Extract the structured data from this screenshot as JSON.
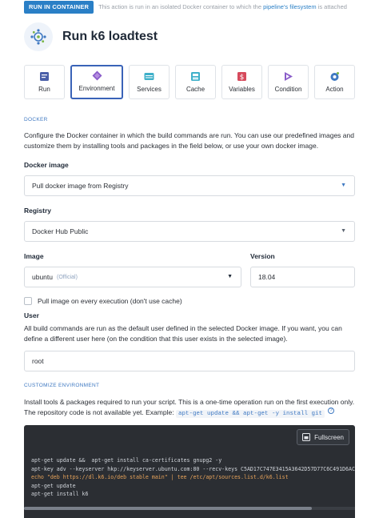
{
  "banner": {
    "badge": "RUN IN CONTAINER",
    "text_before": "This action is run in an isolated Docker container to which the ",
    "link": "pipeline's filesystem",
    "text_after": " is attached"
  },
  "header": {
    "title": "Run k6 loadtest",
    "icon": "k6-action-icon"
  },
  "tabs": [
    {
      "label": "Run",
      "icon": "run-icon",
      "color": "#4a5fa8"
    },
    {
      "label": "Environment",
      "icon": "environment-icon",
      "color": "#8a5cc9",
      "active": true
    },
    {
      "label": "Services",
      "icon": "services-icon",
      "color": "#3fb0c9"
    },
    {
      "label": "Cache",
      "icon": "cache-icon",
      "color": "#3fb0c9"
    },
    {
      "label": "Variables",
      "icon": "variables-icon",
      "color": "#d64a5c"
    },
    {
      "label": "Condition",
      "icon": "condition-icon",
      "color": "#8a5cc9"
    },
    {
      "label": "Action",
      "icon": "action-icon",
      "color": "#3f79c2"
    }
  ],
  "docker_section": {
    "label": "DOCKER",
    "description": "Configure the Docker container in which the build commands are run. You can use our predefined images and customize them by installing tools and packages in the field below, or use your own docker image."
  },
  "docker_image": {
    "label": "Docker image",
    "value": "Pull docker image from Registry"
  },
  "registry": {
    "label": "Registry",
    "value": "Docker Hub Public"
  },
  "image": {
    "label": "Image",
    "value": "ubuntu",
    "tag": "(Official)"
  },
  "version": {
    "label": "Version",
    "value": "18.04"
  },
  "pull_checkbox": {
    "label": "Pull image on every execution (don't use cache)",
    "checked": false
  },
  "user": {
    "label": "User",
    "description": "All build commands are run as the default user defined in the selected Docker image. If you want, you can define a different user here (on the condition that this user exists in the selected image).",
    "value": "root"
  },
  "customize_section": {
    "label": "CUSTOMIZE ENVIRONMENT",
    "description": "Install tools & packages required to run your script. This is a one-time operation run on the first execution only. The repository code is not available yet. Example:",
    "example": "apt-get update && apt-get -y install git"
  },
  "editor": {
    "fullscreen_label": "Fullscreen",
    "lines": [
      "apt-get update &&  apt-get install ca-certificates gnupg2 -y",
      "apt-key adv --keyserver hkp://keyserver.ubuntu.com:80 --recv-keys C5AD17C747E3415A3642D57D77C6C491D6AC",
      "echo \"deb https://dl.k6.io/deb stable main\" | tee /etc/apt/sources.list.d/k6.list",
      "apt-get update",
      "apt-get install k6"
    ]
  }
}
